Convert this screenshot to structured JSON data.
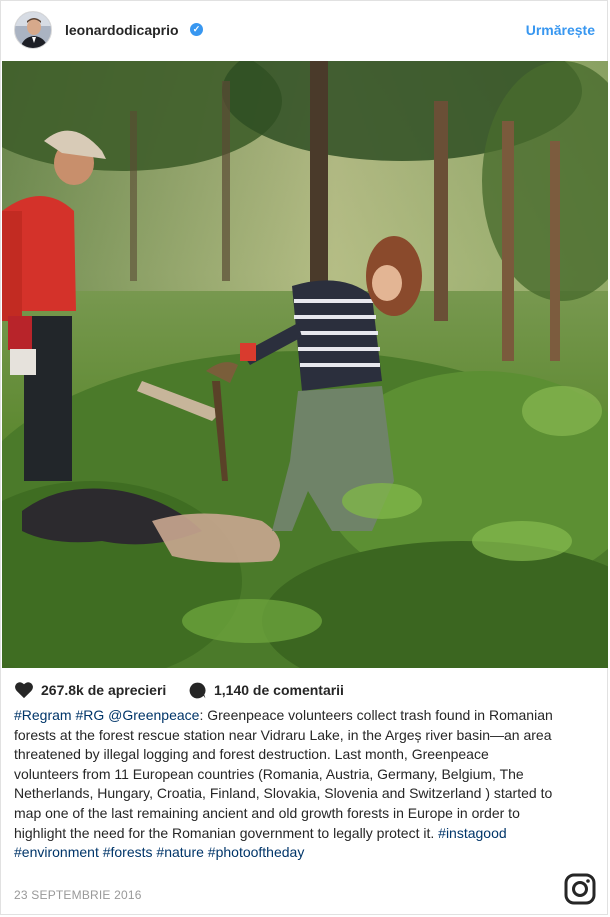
{
  "header": {
    "username": "leonardodicaprio",
    "verified_icon": "verified-badge-icon",
    "follow_label": "Urmărește"
  },
  "post": {
    "photo_icon": "photo",
    "likes_text": "267.8k de aprecieri",
    "comments_text": "1,140 de comentarii",
    "caption": {
      "tags_intro": [
        "#Regram",
        "#RG",
        "@Greenpeace"
      ],
      "body": ": Greenpeace volunteers collect trash found in Romanian forests at the forest rescue station near Vidraru Lake, in the Argeș river basin—an area threatened by illegal logging and forest destruction. Last month, Greenpeace volunteers from 11 European countries (Romania, Austria, Germany, Belgium, The Netherlands, Hungary, Croatia, Finland, Slovakia, Slovenia and Switzerland ) started to map one of the last remaining ancient and old growth forests in Europe in order to highlight the need for the Romanian government to legally protect it. ",
      "tags_outro": [
        "#instagood",
        "#environment",
        "#forests",
        "#nature",
        "#photooftheday"
      ]
    },
    "date": "23 SEPTEMBRIE 2016"
  },
  "colors": {
    "link_blue": "#3897f0",
    "tag_blue": "#003569",
    "text": "#262626",
    "muted": "#999999"
  }
}
